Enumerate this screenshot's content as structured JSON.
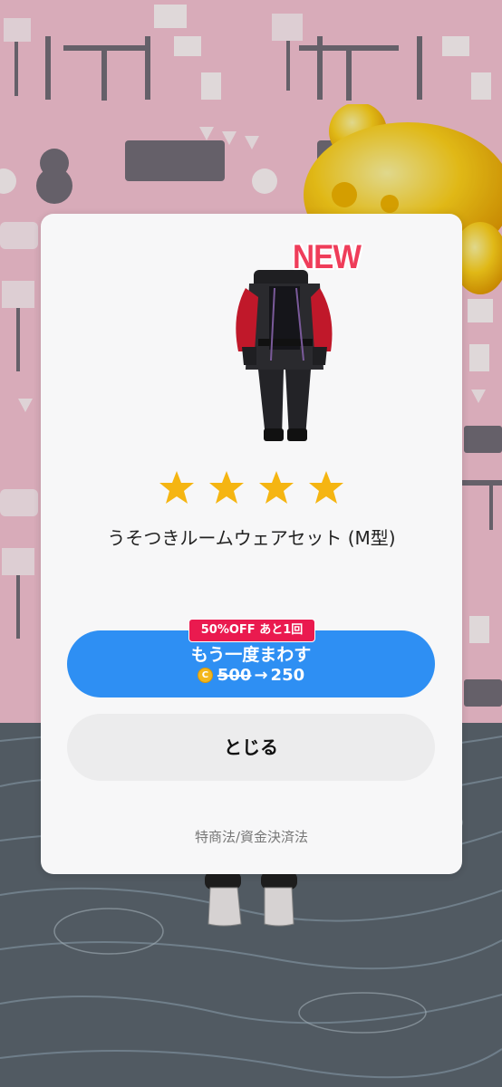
{
  "dialog": {
    "new_badge": "NEW",
    "rating_stars": 4,
    "item_name": "うそつきルームウェアセット (M型)",
    "discount_badge": "50%OFF あと1回",
    "spin_again_label": "もう一度まわす",
    "coin_symbol": "C",
    "old_price": "500",
    "arrow": "→",
    "new_price": "250",
    "close_label": "とじる",
    "legal_link": "特商法/資金決済法"
  },
  "colors": {
    "primary_button": "#2e8ff3",
    "discount_badge": "#ea1a4f",
    "new_badge": "#ef3d5a",
    "star": "#f5b512",
    "wall": "#f6c3d3",
    "floor": "#5d6770"
  },
  "icons": [
    "star-icon",
    "coin-icon",
    "outfit-image"
  ]
}
